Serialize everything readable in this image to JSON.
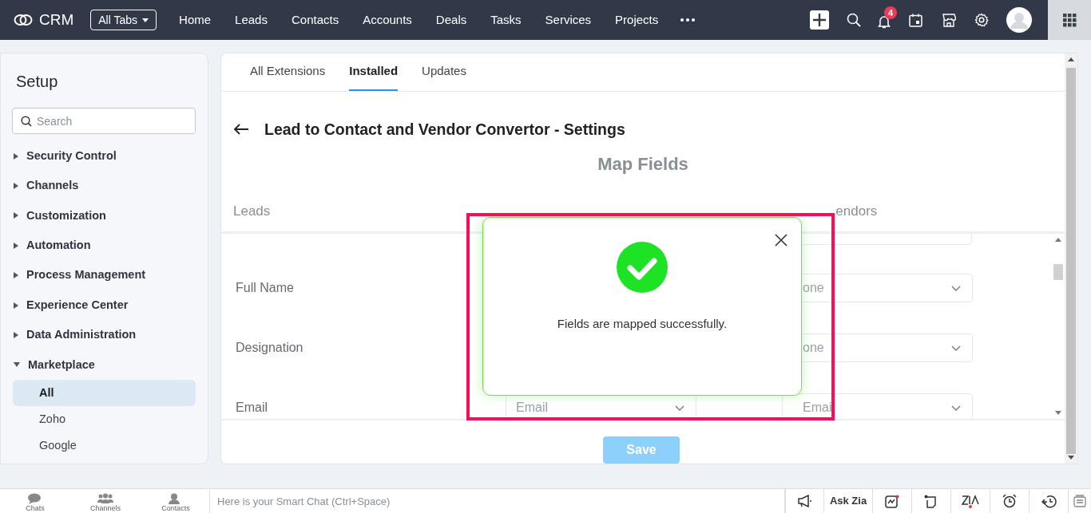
{
  "nav": {
    "logo_text": "CRM",
    "all_tabs": "All Tabs",
    "tabs": [
      "Home",
      "Leads",
      "Contacts",
      "Accounts",
      "Deals",
      "Tasks",
      "Services",
      "Projects"
    ],
    "notification_count": "4"
  },
  "sidebar": {
    "title": "Setup",
    "search": {
      "placeholder": "Search"
    },
    "items": [
      {
        "label": "Security Control",
        "expanded": false
      },
      {
        "label": "Channels",
        "expanded": false
      },
      {
        "label": "Customization",
        "expanded": false
      },
      {
        "label": "Automation",
        "expanded": false
      },
      {
        "label": "Process Management",
        "expanded": false
      },
      {
        "label": "Experience Center",
        "expanded": false
      },
      {
        "label": "Data Administration",
        "expanded": false
      },
      {
        "label": "Marketplace",
        "expanded": true,
        "children": [
          {
            "label": "All",
            "selected": true
          },
          {
            "label": "Zoho",
            "selected": false
          },
          {
            "label": "Google",
            "selected": false
          }
        ]
      }
    ]
  },
  "main": {
    "tabs": [
      {
        "label": "All Extensions",
        "selected": false
      },
      {
        "label": "Installed",
        "selected": true
      },
      {
        "label": "Updates",
        "selected": false
      }
    ],
    "title": "Lead to Contact and Vendor Convertor - Settings",
    "section_title": "Map Fields",
    "columns": [
      "Leads",
      "endors"
    ],
    "rows": [
      {
        "label": "Full Name",
        "target": "one"
      },
      {
        "label": "Designation",
        "target": "one"
      },
      {
        "label": "Email",
        "source": "Email",
        "target": "Email"
      }
    ],
    "save_button": "Save"
  },
  "modal": {
    "message": "Fields are mapped successfully."
  },
  "bottom_bar": {
    "left": [
      {
        "label": "Chats",
        "kind": "chats"
      },
      {
        "label": "Channels",
        "kind": "channels"
      },
      {
        "label": "Contacts",
        "kind": "contacts"
      }
    ],
    "smart_chat_placeholder": "Here is your Smart Chat (Ctrl+Space)",
    "ask_zia": "Ask Zia"
  }
}
